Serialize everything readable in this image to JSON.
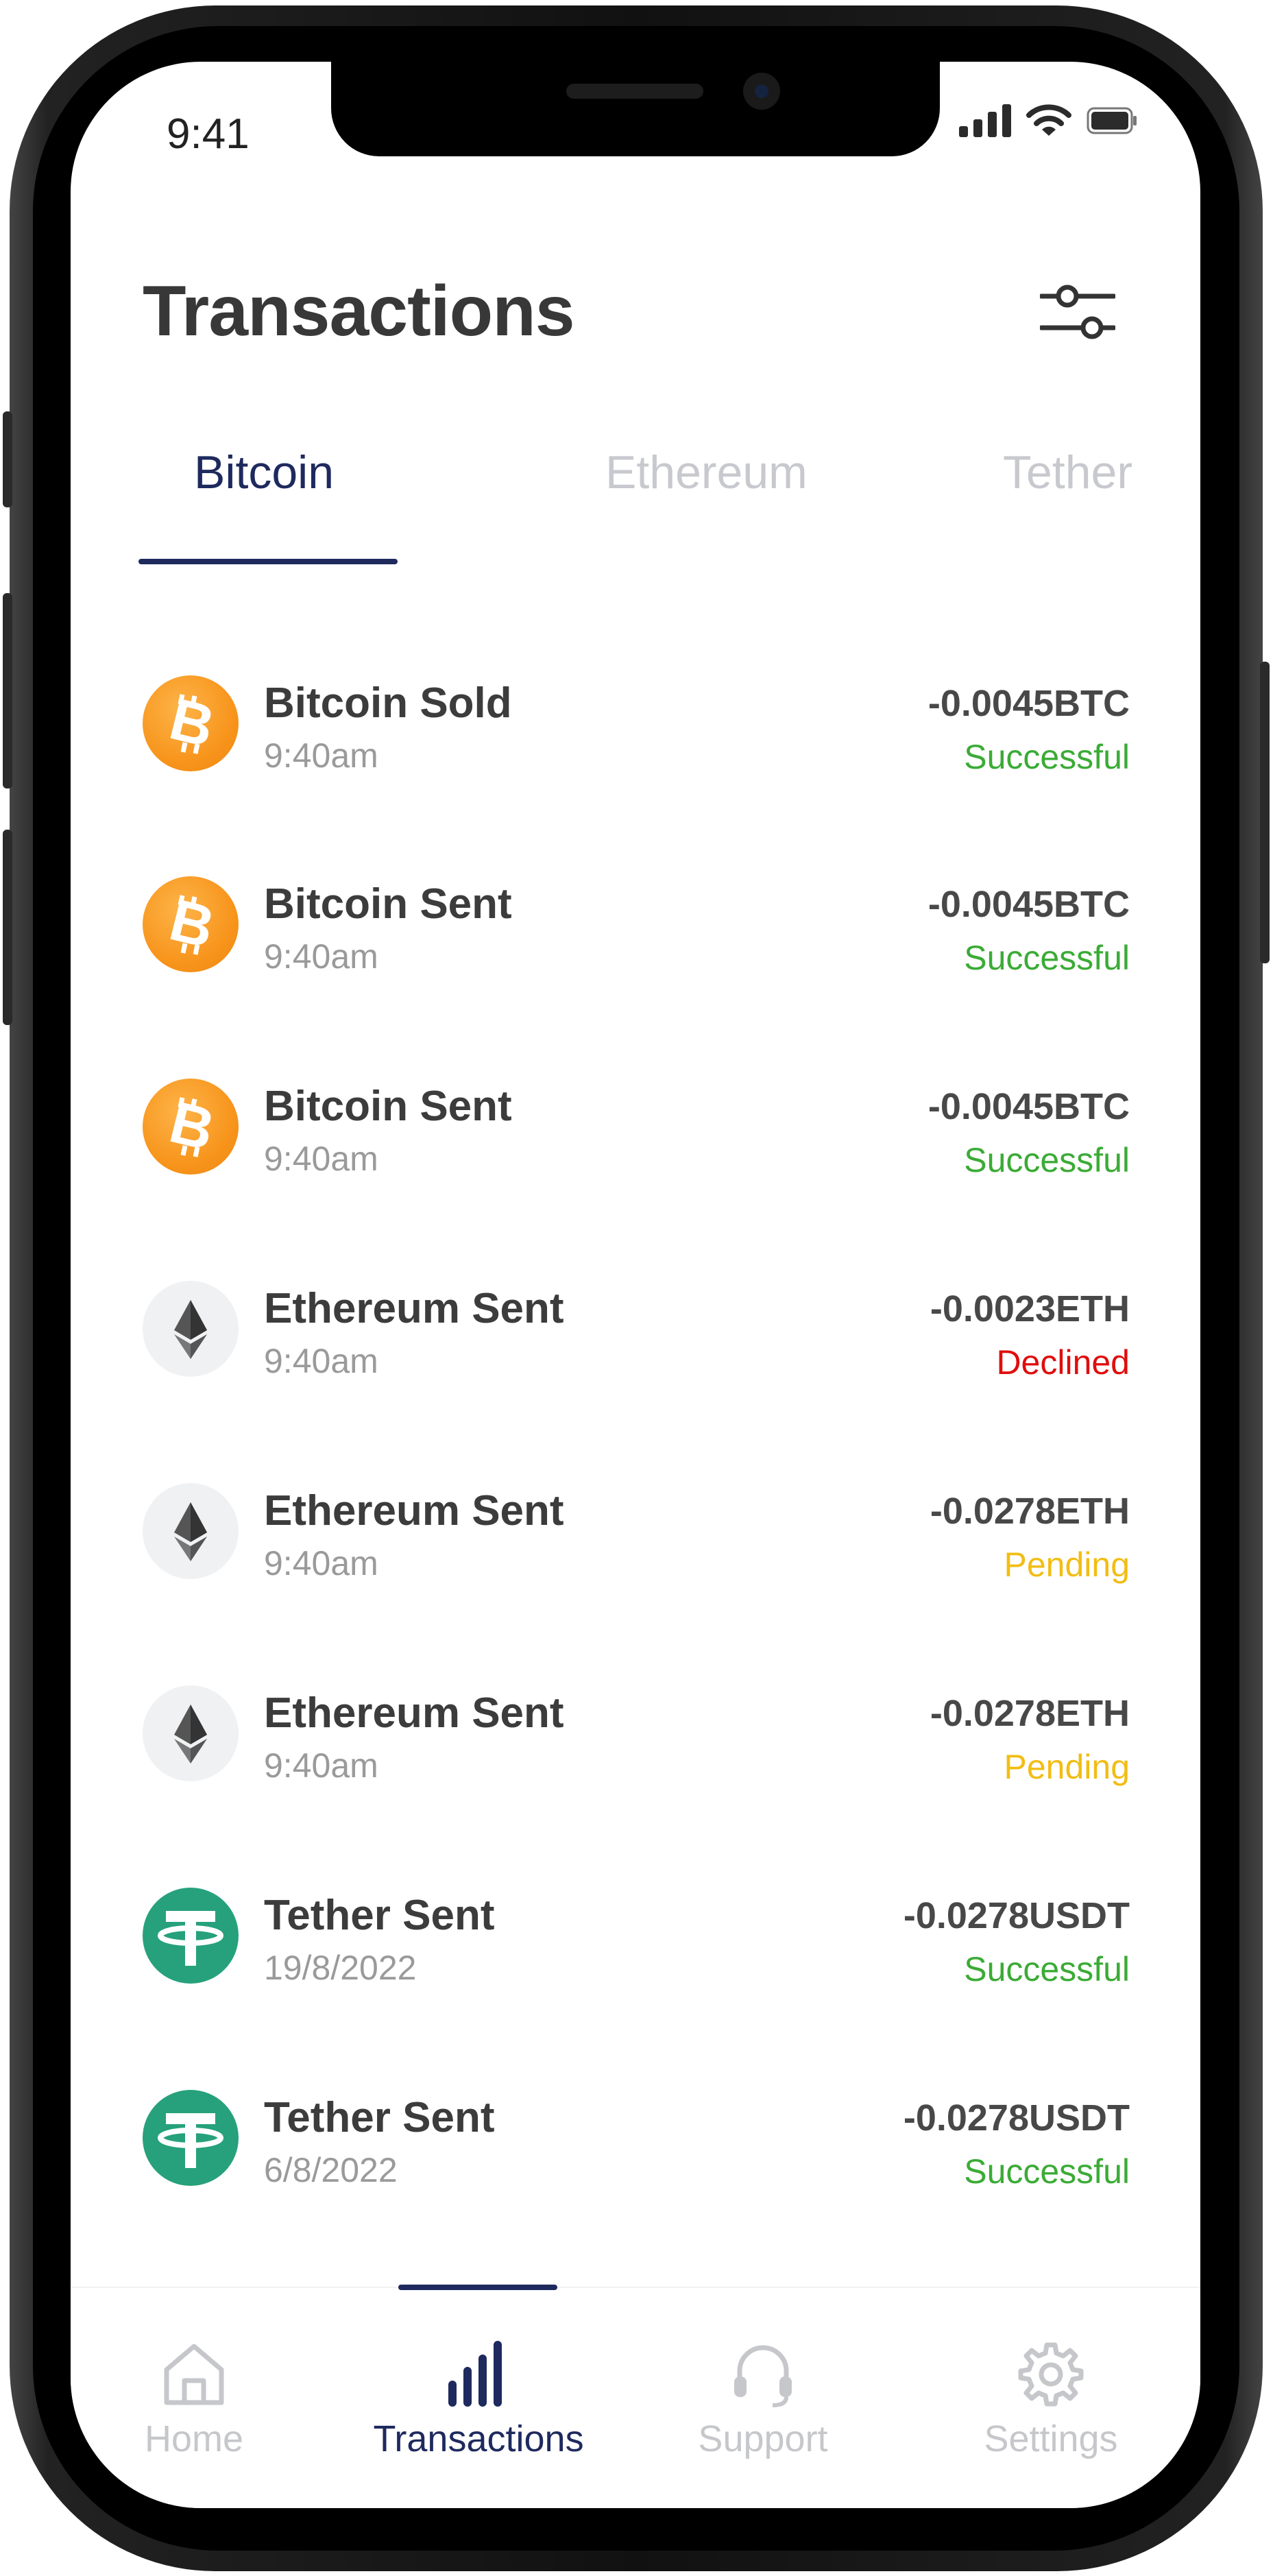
{
  "status_bar": {
    "time": "9:41"
  },
  "header": {
    "title": "Transactions",
    "filter_icon": "sliders-icon"
  },
  "tabs": [
    {
      "label": "Bitcoin",
      "active": true
    },
    {
      "label": "Ethereum",
      "active": false
    },
    {
      "label": "Tether",
      "active": false
    }
  ],
  "transactions": [
    {
      "coin": "bitcoin-icon",
      "title": "Bitcoin Sold",
      "time": "9:40am",
      "amount": "-0.0045BTC",
      "status": "Successful"
    },
    {
      "coin": "bitcoin-icon",
      "title": "Bitcoin Sent",
      "time": "9:40am",
      "amount": "-0.0045BTC",
      "status": "Successful"
    },
    {
      "coin": "bitcoin-icon",
      "title": "Bitcoin Sent",
      "time": "9:40am",
      "amount": "-0.0045BTC",
      "status": "Successful"
    },
    {
      "coin": "ethereum-icon",
      "title": "Ethereum Sent",
      "time": "9:40am",
      "amount": "-0.0023ETH",
      "status": "Declined"
    },
    {
      "coin": "ethereum-icon",
      "title": "Ethereum Sent",
      "time": "9:40am",
      "amount": "-0.0278ETH",
      "status": "Pending"
    },
    {
      "coin": "ethereum-icon",
      "title": "Ethereum Sent",
      "time": "9:40am",
      "amount": "-0.0278ETH",
      "status": "Pending"
    },
    {
      "coin": "tether-icon",
      "title": "Tether Sent",
      "time": "19/8/2022",
      "amount": "-0.0278USDT",
      "status": "Successful"
    },
    {
      "coin": "tether-icon",
      "title": "Tether Sent",
      "time": "6/8/2022",
      "amount": "-0.0278USDT",
      "status": "Successful"
    }
  ],
  "status_colors": {
    "Successful": "#3bab36",
    "Declined": "#e00d0d",
    "Pending": "#f2bd14"
  },
  "bottom_nav": [
    {
      "label": "Home",
      "icon": "home-icon",
      "active": false
    },
    {
      "label": "Transactions",
      "icon": "bar-chart-icon",
      "active": true
    },
    {
      "label": "Support",
      "icon": "headset-icon",
      "active": false
    },
    {
      "label": "Settings",
      "icon": "gear-icon",
      "active": false
    }
  ],
  "colors": {
    "accent": "#1e2a5e",
    "bitcoin": "#f7931a",
    "tether": "#26a17b"
  }
}
